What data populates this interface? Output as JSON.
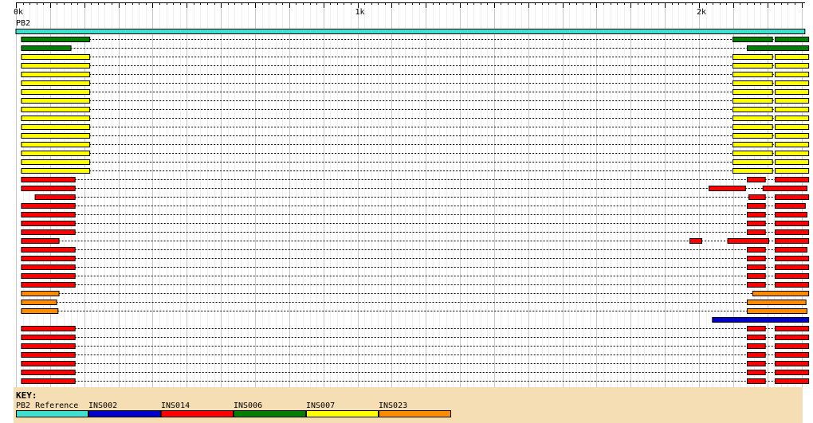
{
  "axis": {
    "max": 2310,
    "ticks": [
      {
        "value": 0,
        "label": "0k"
      },
      {
        "value": 1000,
        "label": "1k"
      },
      {
        "value": 2000,
        "label": "2k"
      }
    ],
    "minor_step": 20,
    "major_step": 100
  },
  "reference": {
    "label": "PB2",
    "start": 0,
    "end": 2310,
    "color": "#40e0d0"
  },
  "colors": {
    "INS002": "#0000cd",
    "INS014": "#ff0000",
    "INS006": "#007f00",
    "INS007": "#ffff00",
    "INS023": "#ff8c00"
  },
  "tracks": [
    {
      "color": "INS006",
      "segments": [
        [
          15,
          215
        ],
        [
          2098,
          2214
        ],
        [
          2222,
          2320
        ]
      ]
    },
    {
      "color": "INS006",
      "segments": [
        [
          15,
          160
        ],
        [
          2140,
          2320
        ]
      ]
    },
    {
      "color": "INS007",
      "segments": [
        [
          15,
          215
        ],
        [
          2098,
          2214
        ],
        [
          2222,
          2320
        ]
      ]
    },
    {
      "color": "INS007",
      "segments": [
        [
          15,
          215
        ],
        [
          2098,
          2214
        ],
        [
          2222,
          2320
        ]
      ]
    },
    {
      "color": "INS007",
      "segments": [
        [
          15,
          215
        ],
        [
          2098,
          2214
        ],
        [
          2222,
          2320
        ]
      ]
    },
    {
      "color": "INS007",
      "segments": [
        [
          15,
          215
        ],
        [
          2098,
          2214
        ],
        [
          2222,
          2320
        ]
      ]
    },
    {
      "color": "INS007",
      "segments": [
        [
          15,
          215
        ],
        [
          2098,
          2214
        ],
        [
          2222,
          2320
        ]
      ]
    },
    {
      "color": "INS007",
      "segments": [
        [
          15,
          215
        ],
        [
          2098,
          2214
        ],
        [
          2222,
          2320
        ]
      ]
    },
    {
      "color": "INS007",
      "segments": [
        [
          15,
          215
        ],
        [
          2098,
          2214
        ],
        [
          2222,
          2320
        ]
      ]
    },
    {
      "color": "INS007",
      "segments": [
        [
          15,
          215
        ],
        [
          2098,
          2214
        ],
        [
          2222,
          2320
        ]
      ]
    },
    {
      "color": "INS007",
      "segments": [
        [
          15,
          215
        ],
        [
          2098,
          2214
        ],
        [
          2222,
          2320
        ]
      ]
    },
    {
      "color": "INS007",
      "segments": [
        [
          15,
          215
        ],
        [
          2098,
          2214
        ],
        [
          2222,
          2320
        ]
      ]
    },
    {
      "color": "INS007",
      "segments": [
        [
          15,
          215
        ],
        [
          2098,
          2214
        ],
        [
          2222,
          2320
        ]
      ]
    },
    {
      "color": "INS007",
      "segments": [
        [
          15,
          215
        ],
        [
          2098,
          2214
        ],
        [
          2222,
          2320
        ]
      ]
    },
    {
      "color": "INS007",
      "segments": [
        [
          15,
          215
        ],
        [
          2098,
          2214
        ],
        [
          2222,
          2320
        ]
      ]
    },
    {
      "color": "INS007",
      "segments": [
        [
          15,
          215
        ],
        [
          2098,
          2214
        ],
        [
          2222,
          2320
        ]
      ]
    },
    {
      "color": "INS014",
      "segments": [
        [
          15,
          172
        ],
        [
          2140,
          2193
        ],
        [
          2222,
          2320
        ]
      ]
    },
    {
      "color": "INS014",
      "segments": [
        [
          15,
          172
        ],
        [
          2028,
          2135
        ],
        [
          2186,
          2315
        ]
      ]
    },
    {
      "color": "INS014",
      "segments": [
        [
          55,
          172
        ],
        [
          2145,
          2193
        ],
        [
          2222,
          2320
        ]
      ]
    },
    {
      "color": "INS014",
      "segments": [
        [
          15,
          172
        ],
        [
          2140,
          2193
        ],
        [
          2222,
          2310
        ]
      ]
    },
    {
      "color": "INS014",
      "segments": [
        [
          15,
          172
        ],
        [
          2140,
          2193
        ],
        [
          2222,
          2315
        ]
      ]
    },
    {
      "color": "INS014",
      "segments": [
        [
          15,
          172
        ],
        [
          2140,
          2193
        ],
        [
          2222,
          2320
        ]
      ]
    },
    {
      "color": "INS014",
      "segments": [
        [
          15,
          172
        ],
        [
          2140,
          2193
        ],
        [
          2222,
          2320
        ]
      ]
    },
    {
      "color": "INS014",
      "segments": [
        [
          15,
          125
        ],
        [
          1972,
          2007
        ],
        [
          2083,
          2203
        ],
        [
          2222,
          2320
        ]
      ]
    },
    {
      "color": "INS014",
      "segments": [
        [
          15,
          172
        ],
        [
          2140,
          2193
        ],
        [
          2222,
          2315
        ]
      ]
    },
    {
      "color": "INS014",
      "segments": [
        [
          15,
          172
        ],
        [
          2140,
          2193
        ],
        [
          2222,
          2320
        ]
      ]
    },
    {
      "color": "INS014",
      "segments": [
        [
          15,
          172
        ],
        [
          2140,
          2193
        ],
        [
          2222,
          2320
        ]
      ]
    },
    {
      "color": "INS014",
      "segments": [
        [
          15,
          172
        ],
        [
          2140,
          2193
        ],
        [
          2222,
          2320
        ]
      ]
    },
    {
      "color": "INS014",
      "segments": [
        [
          15,
          172
        ],
        [
          2140,
          2193
        ],
        [
          2222,
          2320
        ]
      ]
    },
    {
      "color": "INS023",
      "segments": [
        [
          15,
          125
        ],
        [
          2156,
          2320
        ]
      ]
    },
    {
      "color": "INS023",
      "segments": [
        [
          15,
          118
        ],
        [
          2140,
          2312
        ]
      ]
    },
    {
      "color": "INS023",
      "segments": [
        [
          15,
          122
        ],
        [
          2140,
          2315
        ]
      ]
    },
    {
      "color": "INS002",
      "segments": [
        [
          2038,
          2320
        ]
      ]
    },
    {
      "color": "INS014",
      "segments": [
        [
          15,
          172
        ],
        [
          2140,
          2193
        ],
        [
          2222,
          2320
        ]
      ]
    },
    {
      "color": "INS014",
      "segments": [
        [
          15,
          172
        ],
        [
          2140,
          2193
        ],
        [
          2222,
          2320
        ]
      ]
    },
    {
      "color": "INS014",
      "segments": [
        [
          15,
          172
        ],
        [
          2140,
          2193
        ],
        [
          2222,
          2320
        ]
      ]
    },
    {
      "color": "INS014",
      "segments": [
        [
          15,
          172
        ],
        [
          2140,
          2193
        ],
        [
          2222,
          2320
        ]
      ]
    },
    {
      "color": "INS014",
      "segments": [
        [
          15,
          172
        ],
        [
          2140,
          2193
        ],
        [
          2222,
          2320
        ]
      ]
    },
    {
      "color": "INS014",
      "segments": [
        [
          15,
          172
        ],
        [
          2140,
          2193
        ],
        [
          2222,
          2320
        ]
      ]
    },
    {
      "color": "INS014",
      "segments": [
        [
          15,
          172
        ],
        [
          2140,
          2193
        ],
        [
          2222,
          2320
        ]
      ]
    }
  ],
  "key": {
    "title": "KEY:",
    "items": [
      {
        "label": "PB2 Reference",
        "color": "#40e0d0"
      },
      {
        "label": "INS002",
        "color": "#0000cd"
      },
      {
        "label": "INS014",
        "color": "#ff0000"
      },
      {
        "label": "INS006",
        "color": "#007f00"
      },
      {
        "label": "INS007",
        "color": "#ffff00"
      },
      {
        "label": "INS023",
        "color": "#ff8c00"
      }
    ]
  }
}
